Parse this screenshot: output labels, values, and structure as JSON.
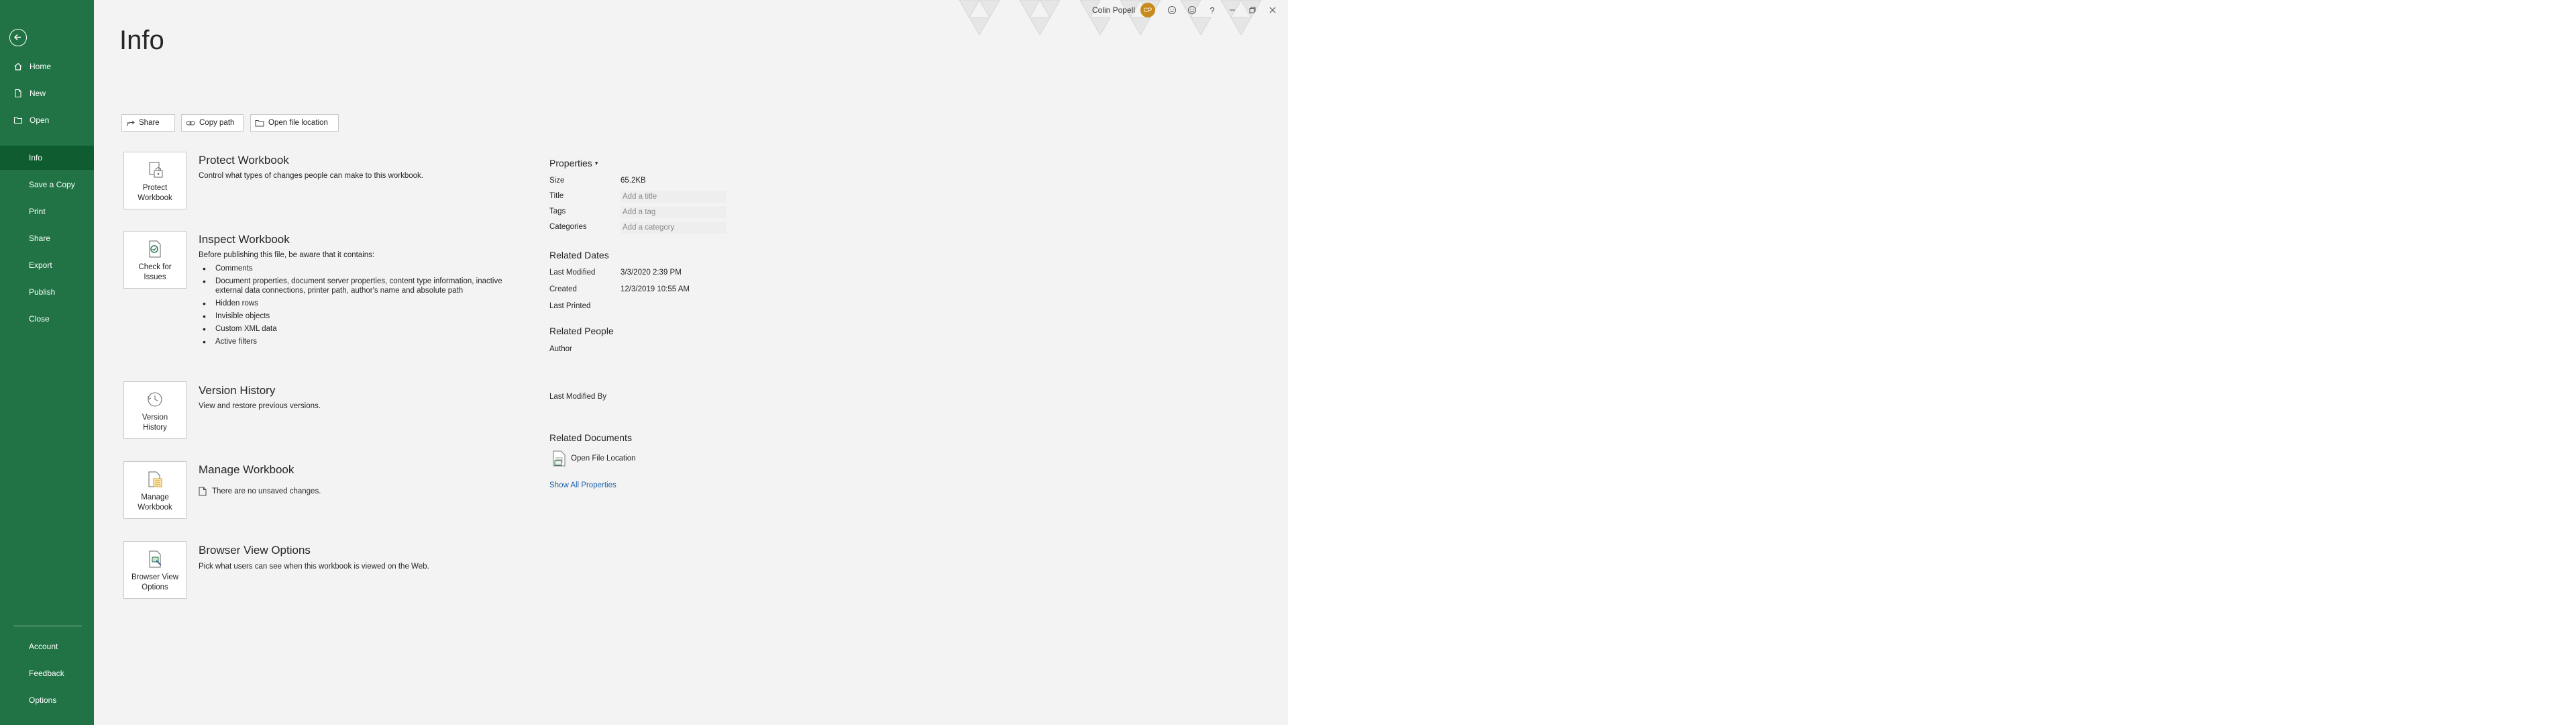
{
  "window": {
    "user_name": "Colin Popell",
    "user_initials": "CP"
  },
  "sidebar": {
    "items": [
      {
        "label": "Home",
        "icon": "home-icon"
      },
      {
        "label": "New",
        "icon": "new-document-icon"
      },
      {
        "label": "Open",
        "icon": "open-folder-icon"
      },
      {
        "label": "Info",
        "selected": true
      },
      {
        "label": "Save a Copy"
      },
      {
        "label": "Print"
      },
      {
        "label": "Share"
      },
      {
        "label": "Export"
      },
      {
        "label": "Publish"
      },
      {
        "label": "Close"
      }
    ],
    "bottom": [
      {
        "label": "Account"
      },
      {
        "label": "Feedback"
      },
      {
        "label": "Options"
      }
    ]
  },
  "page": {
    "title": "Info"
  },
  "actions": {
    "share": "Share",
    "copy_path": "Copy path",
    "open_file_location": "Open file location"
  },
  "sections": {
    "protect": {
      "tile": "Protect Workbook",
      "title": "Protect Workbook",
      "desc": "Control what types of changes people can make to this workbook."
    },
    "inspect": {
      "tile": "Check for Issues",
      "title": "Inspect Workbook",
      "desc": "Before publishing this file, be aware that it contains:",
      "bullets": [
        "Comments",
        "Document properties, document server properties, content type information, inactive external data connections, printer path, author's name and absolute path",
        "Hidden rows",
        "Invisible objects",
        "Custom XML data",
        "Active filters"
      ]
    },
    "version": {
      "tile_line1": "Version",
      "tile_line2": "History",
      "title": "Version History",
      "desc": "View and restore previous versions."
    },
    "manage": {
      "tile": "Manage Workbook",
      "title": "Manage Workbook",
      "desc": "There are no unsaved changes."
    },
    "browser": {
      "tile_line1": "Browser View",
      "tile_line2": "Options",
      "title": "Browser View Options",
      "desc": "Pick what users can see when this workbook is viewed on the Web."
    }
  },
  "properties": {
    "heading": "Properties",
    "rows": [
      {
        "key": "Size",
        "value": "65.2KB"
      },
      {
        "key": "Title",
        "value": "Add a title"
      },
      {
        "key": "Tags",
        "value": "Add a tag"
      },
      {
        "key": "Categories",
        "value": "Add a category"
      }
    ],
    "related_dates_heading": "Related Dates",
    "dates": [
      {
        "key": "Last Modified",
        "value": "3/3/2020 2:39 PM"
      },
      {
        "key": "Created",
        "value": "12/3/2019 10:55 AM"
      },
      {
        "key": "Last Printed",
        "value": ""
      }
    ],
    "related_people_heading": "Related People",
    "author_label": "Author",
    "last_modified_by_label": "Last Modified By",
    "related_documents_heading": "Related Documents",
    "open_file_location": "Open File Location",
    "show_all": "Show All Properties"
  }
}
